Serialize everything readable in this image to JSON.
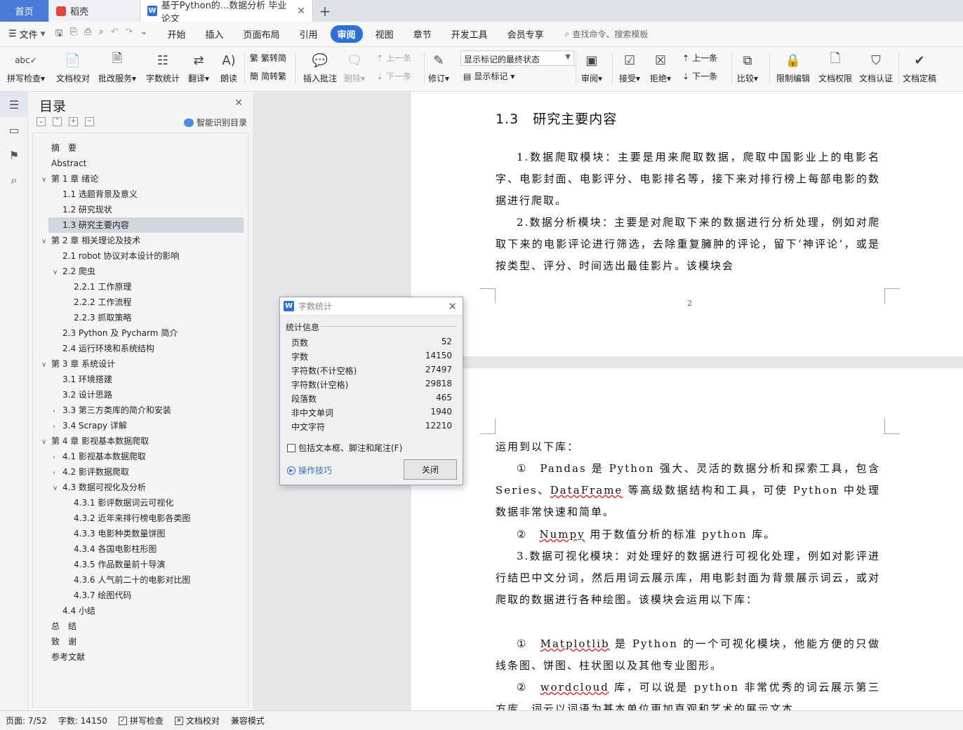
{
  "tabs": {
    "home": "首页",
    "daoke": "稻壳",
    "doc": "基于Python的...数据分析 毕业论文"
  },
  "menubar": {
    "file": "文件",
    "items": [
      "开始",
      "插入",
      "页面布局",
      "引用",
      "审阅",
      "视图",
      "章节",
      "开发工具",
      "会员专享"
    ],
    "active": "审阅",
    "search": "查找命令、搜索模板"
  },
  "ribbon": {
    "spell": "拼写检查",
    "proof": "文档校对",
    "batch": "批改服务",
    "wordcount": "字数统计",
    "translate": "翻译",
    "read": "朗读",
    "to_trad": "繁转简",
    "to_simp": "简转繁",
    "insert_comment": "插入批注",
    "delete": "删除",
    "prev": "上一条",
    "next": "下一条",
    "revise": "修订",
    "display_mode": "显示标记的最终状态",
    "show_marks": "显示标记",
    "review": "审阅",
    "accept": "接受",
    "reject": "拒绝",
    "prev2": "上一条",
    "next2": "下一条",
    "compare": "比较",
    "restrict": "限制编辑",
    "permission": "文档权限",
    "certify": "文档认证",
    "finalize": "文档定稿"
  },
  "toc": {
    "title": "目录",
    "smart": "智能识别目录",
    "items": [
      {
        "text": "摘　要"
      },
      {
        "text": "Abstract"
      },
      {
        "text": "第 1 章  绪论"
      },
      {
        "text": "1.1    选题背景及意义"
      },
      {
        "text": "1.2    研究现状"
      },
      {
        "text": "1.3    研究主要内容"
      },
      {
        "text": "第 2 章  相关理论及技术"
      },
      {
        "text": "2.1 robot 协议对本设计的影响"
      },
      {
        "text": "2.2  爬虫"
      },
      {
        "text": "2.2.1  工作原理"
      },
      {
        "text": "2.2.2  工作流程"
      },
      {
        "text": "2.2.3  抓取策略"
      },
      {
        "text": "2.3 Python 及 Pycharm 简介"
      },
      {
        "text": "2.4 运行环境和系统结构"
      },
      {
        "text": "第 3 章  系统设计"
      },
      {
        "text": "3.1 环境搭建"
      },
      {
        "text": "3.2 设计思路"
      },
      {
        "text": "3.3  第三方类库的简介和安装"
      },
      {
        "text": "3.4 Scrapy 详解"
      },
      {
        "text": "第 4 章  影视基本数据爬取"
      },
      {
        "text": "4.1    影视基本数据爬取"
      },
      {
        "text": "4.2    影评数据爬取"
      },
      {
        "text": "4.3    数据可视化及分析"
      },
      {
        "text": "4.3.1    影评数据词云可视化"
      },
      {
        "text": "4.3.2    近年来排行榜电影各类图"
      },
      {
        "text": "4.3.3    电影种类数量饼图"
      },
      {
        "text": "4.3.4    各国电影柱形图"
      },
      {
        "text": "4.3.5    作品数量前十导演"
      },
      {
        "text": "4.3.6    人气前二十的电影对比图"
      },
      {
        "text": "4.3.7    绘图代码"
      },
      {
        "text": "4.4    小结"
      },
      {
        "text": "总　结"
      },
      {
        "text": "致　谢"
      },
      {
        "text": "参考文献"
      }
    ]
  },
  "doc": {
    "heading": "1.3　研究主要内容",
    "p1": "1.数据爬取模块：主要是用来爬取数据，爬取中国影业上的电影名字、电影封面、电影评分、电影排名等，接下来对排行榜上每部电影的数据进行爬取。",
    "p2": "2.数据分析模块：主要是对爬取下来的数据进行分析处理，例如对爬取下来的电影评论进行筛选，去除重复臃肿的评论，留下‘神评论’，或是按类型、评分、时间选出最佳影片。该模块会",
    "page_number": "2",
    "p3": "运用到以下库：",
    "p4_a": "①　",
    "p4_b": "Pandas 是 Python 强大、灵活的数据分析和探索工具，包含 Series、",
    "p4_c": "DataFrame",
    "p4_d": " 等高级数据结构和工具，可使 Python 中处理数据非常快速和简单。",
    "p5_a": "②　",
    "p5_b": "Numpy",
    "p5_c": " 用于数值分析的标准 python 库。",
    "p6": "3.数据可视化模块：对处理好的数据进行可视化处理，例如对影评进行结巴中文分词，然后用词云展示库，用电影封面为背景展示词云，或对爬取的数据进行各种绘图。该模块会运用以下库：",
    "p7_a": "①　",
    "p7_b": "Matplotlib",
    "p7_c": " 是 Python 的一个可视化模块，他能方便的只做线条图、饼图、柱状图以及其他专业图形。",
    "p8_a": "②　",
    "p8_b": "wordcloud",
    "p8_c": " 库，可以说是 python 非常优秀的词云展示第三方库，词云以词语为基本单位更加直观和艺术的展示文本"
  },
  "dialog": {
    "title": "字数统计",
    "section": "统计信息",
    "stats": [
      {
        "label": "页数",
        "value": "52"
      },
      {
        "label": "字数",
        "value": "14150"
      },
      {
        "label": "字符数(不计空格)",
        "value": "27497"
      },
      {
        "label": "字符数(计空格)",
        "value": "29818"
      },
      {
        "label": "段落数",
        "value": "465"
      },
      {
        "label": "非中文单词",
        "value": "1940"
      },
      {
        "label": "中文字符",
        "value": "12210"
      }
    ],
    "include": "包括文本框、脚注和尾注(F)",
    "tips": "操作技巧",
    "close": "关闭"
  },
  "status": {
    "page": "页面: 7/52",
    "words": "字数: 14150",
    "spell": "拼写检查",
    "proof": "文档校对",
    "compat": "兼容模式"
  }
}
